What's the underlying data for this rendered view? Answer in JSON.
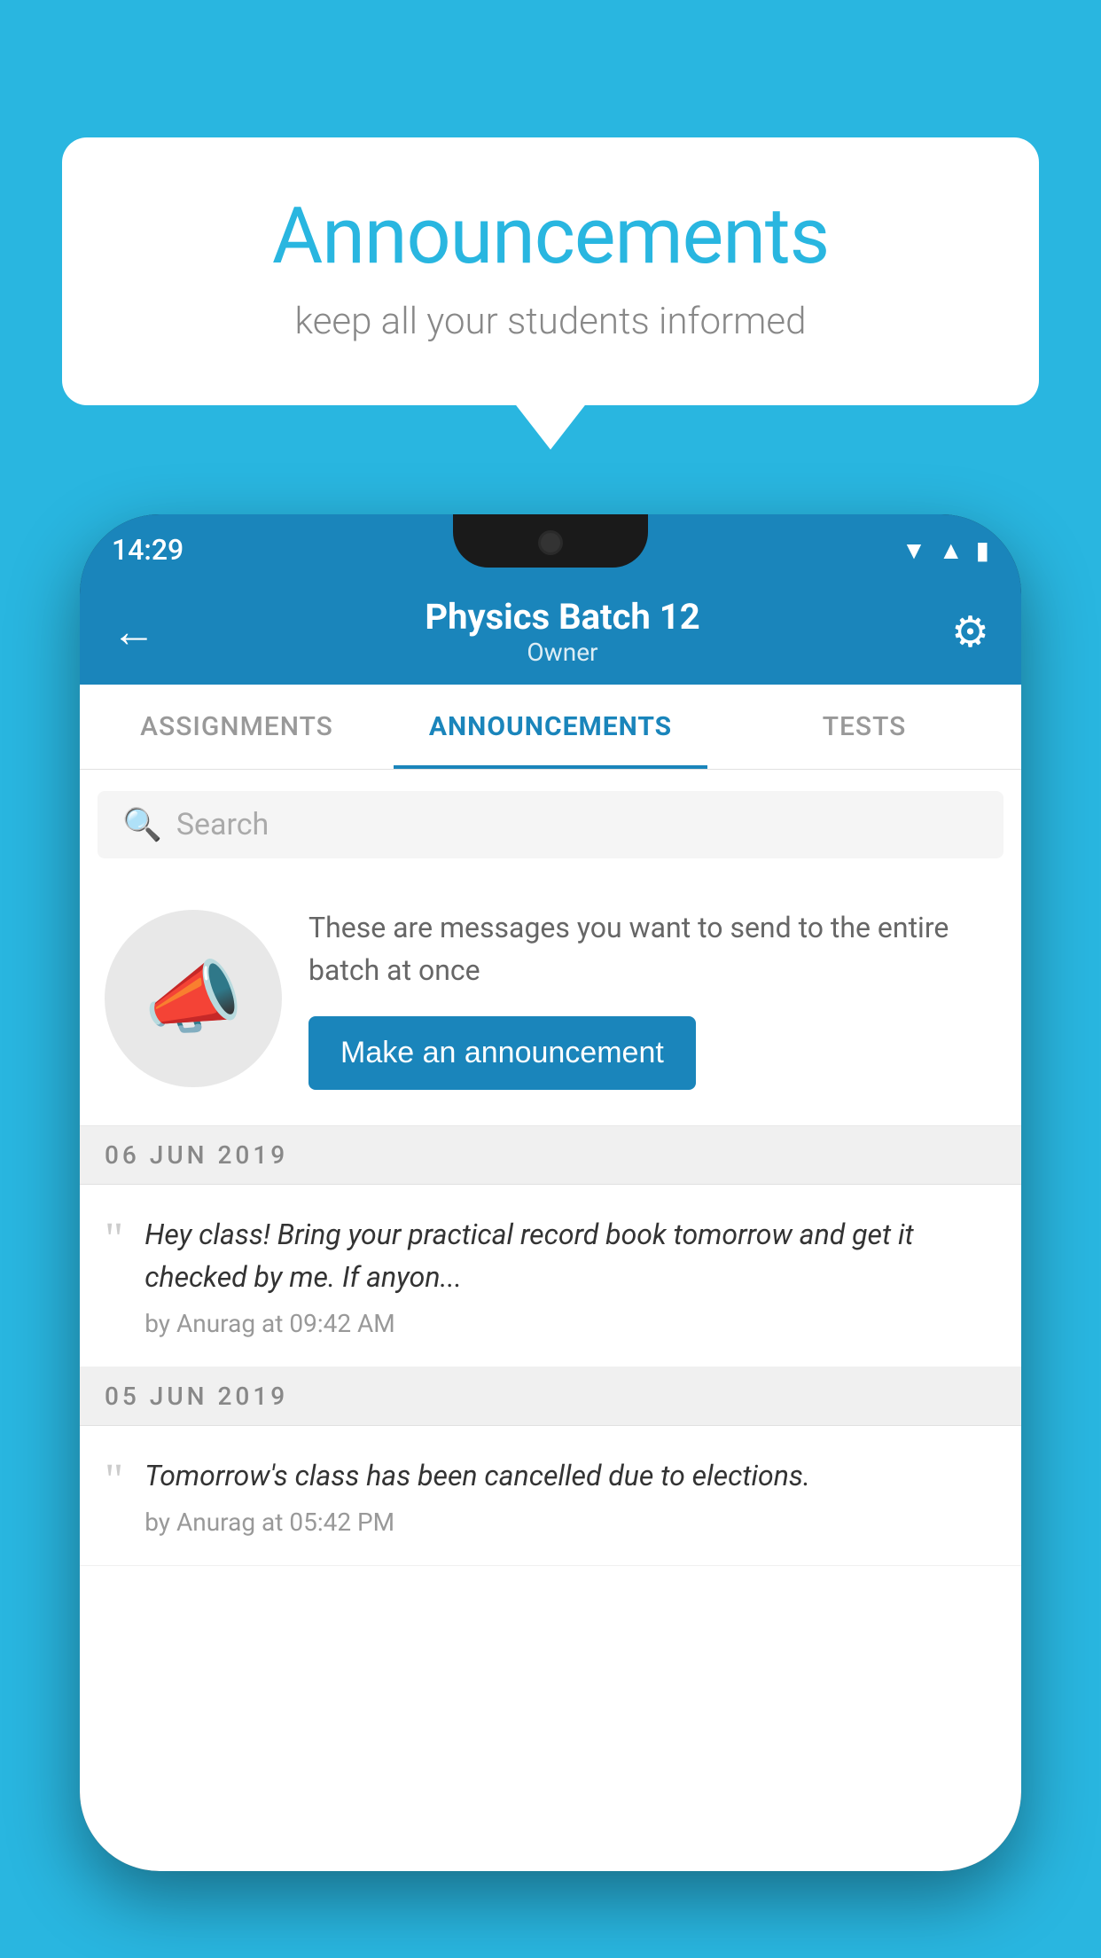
{
  "background_color": "#29b6e0",
  "speech_bubble": {
    "title": "Announcements",
    "subtitle": "keep all your students informed"
  },
  "phone": {
    "status_bar": {
      "time": "14:29"
    },
    "app_bar": {
      "title": "Physics Batch 12",
      "subtitle": "Owner",
      "back_label": "←",
      "settings_label": "⚙"
    },
    "tabs": [
      {
        "label": "ASSIGNMENTS",
        "active": false
      },
      {
        "label": "ANNOUNCEMENTS",
        "active": true
      },
      {
        "label": "TESTS",
        "active": false
      },
      {
        "label": "",
        "active": false
      }
    ],
    "search": {
      "placeholder": "Search"
    },
    "promo": {
      "description": "These are messages you want to send to the entire batch at once",
      "button_label": "Make an announcement"
    },
    "announcements": [
      {
        "date": "06  JUN  2019",
        "text": "Hey class! Bring your practical record book tomorrow and get it checked by me. If anyon...",
        "meta": "by Anurag at 09:42 AM"
      },
      {
        "date": "05  JUN  2019",
        "text": "Tomorrow's class has been cancelled due to elections.",
        "meta": "by Anurag at 05:42 PM"
      }
    ]
  }
}
